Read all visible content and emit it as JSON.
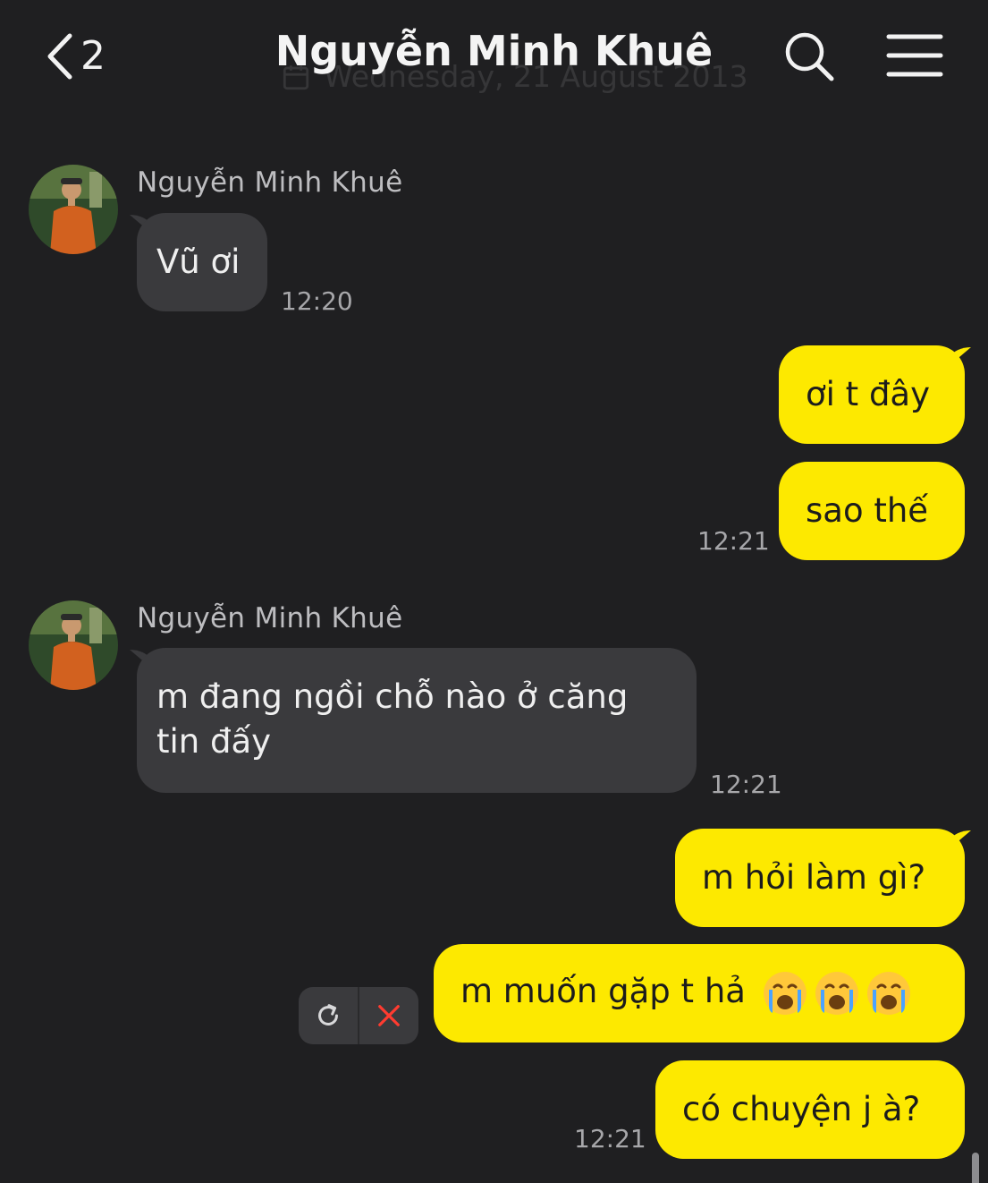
{
  "header": {
    "back_count": "2",
    "title": "Nguyễn Minh Khuê",
    "date_label": "Wednesday, 21 August 2013"
  },
  "messages": [
    {
      "sender": "Nguyễn Minh Khuê",
      "text": "Vũ ơi",
      "time": "12:20"
    },
    {
      "text": "ơi t đây"
    },
    {
      "text": "sao thế",
      "time": "12:21"
    },
    {
      "sender": "Nguyễn Minh Khuê",
      "line1": "m đang ngồi chỗ nào ở căng",
      "line2": "tin đấy",
      "time": "12:21"
    },
    {
      "text": "m hỏi làm gì?"
    },
    {
      "text": "m muốn gặp t hả",
      "emoji": [
        "loudly-crying-face",
        "loudly-crying-face",
        "loudly-crying-face"
      ]
    },
    {
      "text": "có chuyện j à?",
      "time": "12:21"
    }
  ],
  "colors": {
    "background": "#1f1f21",
    "incoming_bubble": "#3a3a3d",
    "outgoing_bubble": "#fde900",
    "failed_icon": "#ff3b30"
  }
}
